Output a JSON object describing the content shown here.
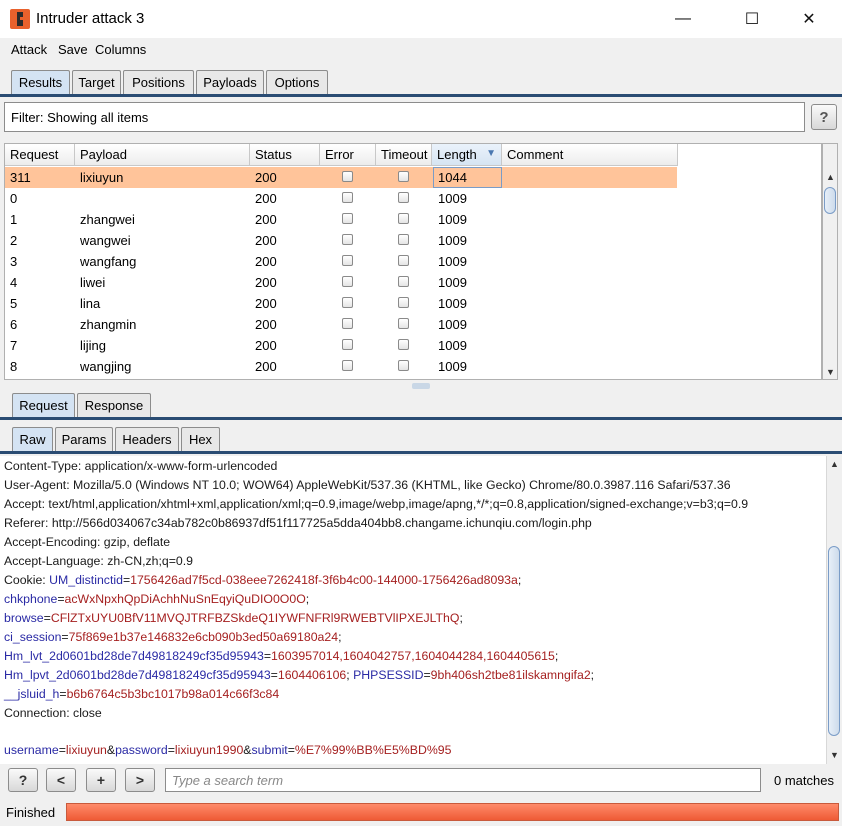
{
  "window": {
    "title": "Intruder attack 3",
    "min": "—",
    "max": "☐",
    "close": "✕"
  },
  "menu": [
    "Attack",
    "Save",
    "Columns"
  ],
  "tabs": [
    "Results",
    "Target",
    "Positions",
    "Payloads",
    "Options"
  ],
  "filter": {
    "text": "Filter: Showing all items",
    "help": "?"
  },
  "table": {
    "columns": [
      "Request",
      "Payload",
      "Status",
      "Error",
      "Timeout",
      "Length",
      "Comment"
    ],
    "sort_indicator": "▼",
    "rows": [
      {
        "request": "311",
        "payload": "lixiuyun",
        "status": "200",
        "length": "1044",
        "selected": true
      },
      {
        "request": "0",
        "payload": "",
        "status": "200",
        "length": "1009"
      },
      {
        "request": "1",
        "payload": "zhangwei",
        "status": "200",
        "length": "1009"
      },
      {
        "request": "2",
        "payload": "wangwei",
        "status": "200",
        "length": "1009"
      },
      {
        "request": "3",
        "payload": "wangfang",
        "status": "200",
        "length": "1009"
      },
      {
        "request": "4",
        "payload": "liwei",
        "status": "200",
        "length": "1009"
      },
      {
        "request": "5",
        "payload": "lina",
        "status": "200",
        "length": "1009"
      },
      {
        "request": "6",
        "payload": "zhangmin",
        "status": "200",
        "length": "1009"
      },
      {
        "request": "7",
        "payload": "lijing",
        "status": "200",
        "length": "1009"
      },
      {
        "request": "8",
        "payload": "wangjing",
        "status": "200",
        "length": "1009"
      }
    ]
  },
  "message_tabs": [
    "Request",
    "Response"
  ],
  "view_tabs": [
    "Raw",
    "Params",
    "Headers",
    "Hex"
  ],
  "request": {
    "content_type": "Content-Type: application/x-www-form-urlencoded",
    "user_agent": "User-Agent: Mozilla/5.0 (Windows NT 10.0; WOW64) AppleWebKit/537.36 (KHTML, like Gecko) Chrome/80.0.3987.116 Safari/537.36",
    "accept": "Accept: text/html,application/xhtml+xml,application/xml;q=0.9,image/webp,image/apng,*/*;q=0.8,application/signed-exchange;v=b3;q=0.9",
    "referer": "Referer: http://566d034067c34ab782c0b86937df51f117725a5dda404bb8.changame.ichunqiu.com/login.php",
    "accept_encoding": "Accept-Encoding: gzip, deflate",
    "accept_language": "Accept-Language: zh-CN,zh;q=0.9",
    "cookie_prefix": "Cookie: ",
    "cookies": [
      {
        "k": "UM_distinctid",
        "v": "1756426ad7f5cd-038eee7262418f-3f6b4c00-144000-1756426ad8093a",
        "sep": ";"
      },
      {
        "k": "chkphone",
        "v": "acWxNpxhQpDiAchhNuSnEqyiQuDIO0O0O",
        "sep": ";"
      },
      {
        "k": "browse",
        "v": "CFlZTxUYU0BfV11MVQJTRFBZSkdeQ1IYWFNFRl9RWEBTVlIPXEJLThQ",
        "sep": ";"
      },
      {
        "k": "ci_session",
        "v": "75f869e1b37e146832e6cb090b3ed50a69180a24",
        "sep": ";"
      },
      {
        "k": "Hm_lvt_2d0601bd28de7d49818249cf35d95943",
        "v": "1603957014,1604042757,1604044284,1604405615",
        "sep": ";"
      },
      {
        "k": "Hm_lpvt_2d0601bd28de7d49818249cf35d95943",
        "v": "1604406106",
        "sep": ";"
      },
      {
        "k": "PHPSESSID",
        "v": "9bh406sh2tbe81ilskamngifa2",
        "sep": ";"
      },
      {
        "k": "__jsluid_h",
        "v": "b6b6764c5b3bc1017b98a014c66f3c84",
        "sep": ""
      }
    ],
    "connection": "Connection: close",
    "body": [
      {
        "k": "username",
        "v": "lixiuyun"
      },
      {
        "k": "password",
        "v": "lixiuyun1990"
      },
      {
        "k": "submit",
        "v": "%E7%99%BB%E5%BD%95"
      }
    ]
  },
  "search": {
    "help": "?",
    "prev": "<",
    "add": "+",
    "next": ">",
    "placeholder": "Type a search term",
    "matches": "0 matches"
  },
  "status": {
    "text": "Finished",
    "progress": 1.0
  },
  "colors": {
    "selected_row": "#ffc49a",
    "progress": "#f06a45",
    "tab_active": "#d4e3f3",
    "param_name": "#2a2aa5",
    "param_value": "#a52020"
  }
}
